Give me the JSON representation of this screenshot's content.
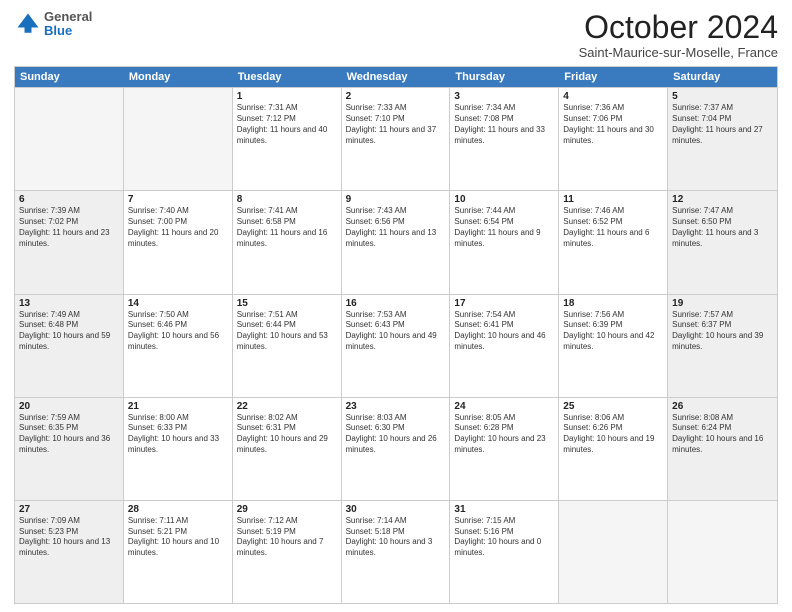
{
  "header": {
    "logo_general": "General",
    "logo_blue": "Blue",
    "title": "October 2024",
    "location": "Saint-Maurice-sur-Moselle, France"
  },
  "days_of_week": [
    "Sunday",
    "Monday",
    "Tuesday",
    "Wednesday",
    "Thursday",
    "Friday",
    "Saturday"
  ],
  "rows": [
    [
      {
        "day": "",
        "info": "",
        "empty": true
      },
      {
        "day": "",
        "info": "",
        "empty": true
      },
      {
        "day": "1",
        "info": "Sunrise: 7:31 AM\nSunset: 7:12 PM\nDaylight: 11 hours and 40 minutes."
      },
      {
        "day": "2",
        "info": "Sunrise: 7:33 AM\nSunset: 7:10 PM\nDaylight: 11 hours and 37 minutes."
      },
      {
        "day": "3",
        "info": "Sunrise: 7:34 AM\nSunset: 7:08 PM\nDaylight: 11 hours and 33 minutes."
      },
      {
        "day": "4",
        "info": "Sunrise: 7:36 AM\nSunset: 7:06 PM\nDaylight: 11 hours and 30 minutes."
      },
      {
        "day": "5",
        "info": "Sunrise: 7:37 AM\nSunset: 7:04 PM\nDaylight: 11 hours and 27 minutes.",
        "shaded": true
      }
    ],
    [
      {
        "day": "6",
        "info": "Sunrise: 7:39 AM\nSunset: 7:02 PM\nDaylight: 11 hours and 23 minutes.",
        "shaded": true
      },
      {
        "day": "7",
        "info": "Sunrise: 7:40 AM\nSunset: 7:00 PM\nDaylight: 11 hours and 20 minutes."
      },
      {
        "day": "8",
        "info": "Sunrise: 7:41 AM\nSunset: 6:58 PM\nDaylight: 11 hours and 16 minutes."
      },
      {
        "day": "9",
        "info": "Sunrise: 7:43 AM\nSunset: 6:56 PM\nDaylight: 11 hours and 13 minutes."
      },
      {
        "day": "10",
        "info": "Sunrise: 7:44 AM\nSunset: 6:54 PM\nDaylight: 11 hours and 9 minutes."
      },
      {
        "day": "11",
        "info": "Sunrise: 7:46 AM\nSunset: 6:52 PM\nDaylight: 11 hours and 6 minutes."
      },
      {
        "day": "12",
        "info": "Sunrise: 7:47 AM\nSunset: 6:50 PM\nDaylight: 11 hours and 3 minutes.",
        "shaded": true
      }
    ],
    [
      {
        "day": "13",
        "info": "Sunrise: 7:49 AM\nSunset: 6:48 PM\nDaylight: 10 hours and 59 minutes.",
        "shaded": true
      },
      {
        "day": "14",
        "info": "Sunrise: 7:50 AM\nSunset: 6:46 PM\nDaylight: 10 hours and 56 minutes."
      },
      {
        "day": "15",
        "info": "Sunrise: 7:51 AM\nSunset: 6:44 PM\nDaylight: 10 hours and 53 minutes."
      },
      {
        "day": "16",
        "info": "Sunrise: 7:53 AM\nSunset: 6:43 PM\nDaylight: 10 hours and 49 minutes."
      },
      {
        "day": "17",
        "info": "Sunrise: 7:54 AM\nSunset: 6:41 PM\nDaylight: 10 hours and 46 minutes."
      },
      {
        "day": "18",
        "info": "Sunrise: 7:56 AM\nSunset: 6:39 PM\nDaylight: 10 hours and 42 minutes."
      },
      {
        "day": "19",
        "info": "Sunrise: 7:57 AM\nSunset: 6:37 PM\nDaylight: 10 hours and 39 minutes.",
        "shaded": true
      }
    ],
    [
      {
        "day": "20",
        "info": "Sunrise: 7:59 AM\nSunset: 6:35 PM\nDaylight: 10 hours and 36 minutes.",
        "shaded": true
      },
      {
        "day": "21",
        "info": "Sunrise: 8:00 AM\nSunset: 6:33 PM\nDaylight: 10 hours and 33 minutes."
      },
      {
        "day": "22",
        "info": "Sunrise: 8:02 AM\nSunset: 6:31 PM\nDaylight: 10 hours and 29 minutes."
      },
      {
        "day": "23",
        "info": "Sunrise: 8:03 AM\nSunset: 6:30 PM\nDaylight: 10 hours and 26 minutes."
      },
      {
        "day": "24",
        "info": "Sunrise: 8:05 AM\nSunset: 6:28 PM\nDaylight: 10 hours and 23 minutes."
      },
      {
        "day": "25",
        "info": "Sunrise: 8:06 AM\nSunset: 6:26 PM\nDaylight: 10 hours and 19 minutes."
      },
      {
        "day": "26",
        "info": "Sunrise: 8:08 AM\nSunset: 6:24 PM\nDaylight: 10 hours and 16 minutes.",
        "shaded": true
      }
    ],
    [
      {
        "day": "27",
        "info": "Sunrise: 7:09 AM\nSunset: 5:23 PM\nDaylight: 10 hours and 13 minutes.",
        "shaded": true
      },
      {
        "day": "28",
        "info": "Sunrise: 7:11 AM\nSunset: 5:21 PM\nDaylight: 10 hours and 10 minutes."
      },
      {
        "day": "29",
        "info": "Sunrise: 7:12 AM\nSunset: 5:19 PM\nDaylight: 10 hours and 7 minutes."
      },
      {
        "day": "30",
        "info": "Sunrise: 7:14 AM\nSunset: 5:18 PM\nDaylight: 10 hours and 3 minutes."
      },
      {
        "day": "31",
        "info": "Sunrise: 7:15 AM\nSunset: 5:16 PM\nDaylight: 10 hours and 0 minutes."
      },
      {
        "day": "",
        "info": "",
        "empty": true
      },
      {
        "day": "",
        "info": "",
        "empty": true
      }
    ]
  ]
}
